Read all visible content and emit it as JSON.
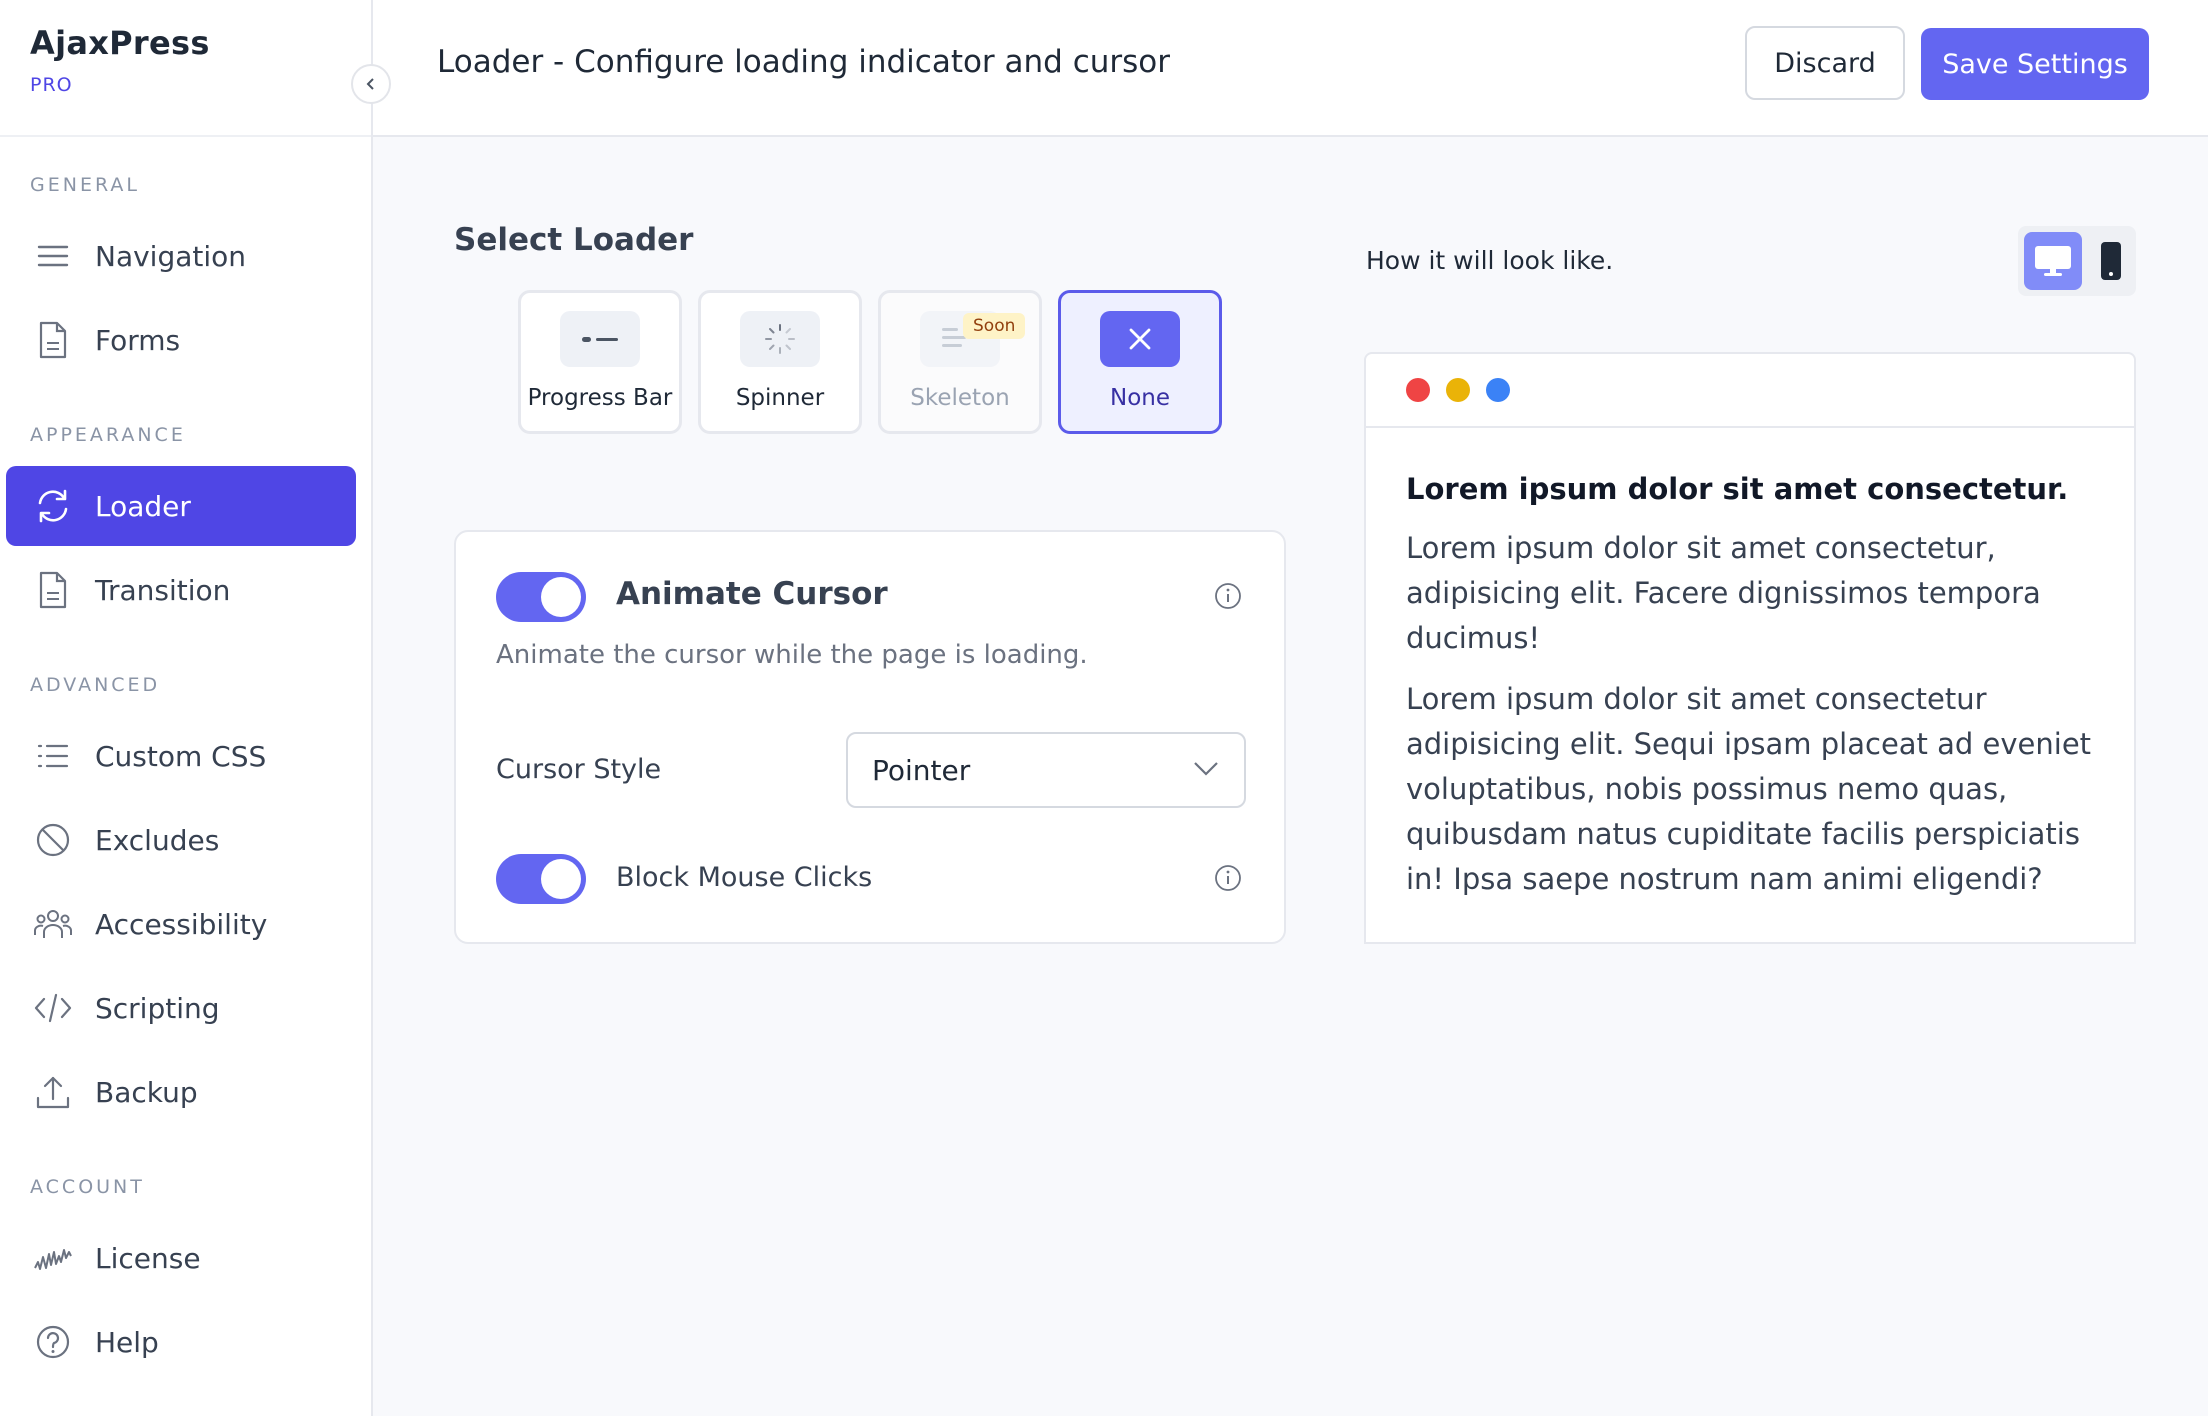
{
  "brand": {
    "name": "AjaxPress",
    "tier": "PRO"
  },
  "sidebar": {
    "sections": [
      {
        "title": "GENERAL"
      },
      {
        "title": "APPEARANCE"
      },
      {
        "title": "ADVANCED"
      },
      {
        "title": "ACCOUNT"
      }
    ],
    "items": [
      {
        "label": "Navigation",
        "icon": "menu-icon"
      },
      {
        "label": "Forms",
        "icon": "document-icon"
      },
      {
        "label": "Loader",
        "icon": "refresh-icon",
        "active": true
      },
      {
        "label": "Transition",
        "icon": "document-icon"
      },
      {
        "label": "Custom CSS",
        "icon": "list-icon"
      },
      {
        "label": "Excludes",
        "icon": "ban-icon"
      },
      {
        "label": "Accessibility",
        "icon": "users-icon"
      },
      {
        "label": "Scripting",
        "icon": "code-icon"
      },
      {
        "label": "Backup",
        "icon": "upload-icon"
      },
      {
        "label": "License",
        "icon": "signature-icon"
      },
      {
        "label": "Help",
        "icon": "help-icon"
      }
    ]
  },
  "header": {
    "title": "Loader - Configure loading indicator and cursor",
    "discard_label": "Discard",
    "save_label": "Save Settings"
  },
  "loader": {
    "title": "Select Loader",
    "options": [
      {
        "label": "Progress Bar",
        "icon": "progress-bar-icon"
      },
      {
        "label": "Spinner",
        "icon": "spinner-icon"
      },
      {
        "label": "Skeleton",
        "icon": "skeleton-icon",
        "badge": "Soon",
        "disabled": true
      },
      {
        "label": "None",
        "icon": "close-icon",
        "selected": true
      }
    ]
  },
  "settings": {
    "animate_cursor": {
      "title": "Animate Cursor",
      "description": "Animate the cursor while the page is loading.",
      "enabled": true
    },
    "cursor_style": {
      "label": "Cursor Style",
      "value": "Pointer"
    },
    "block_clicks": {
      "label": "Block Mouse Clicks",
      "enabled": true
    }
  },
  "preview": {
    "label": "How it will look like.",
    "heading": "Lorem ipsum dolor sit amet consectetur.",
    "paragraphs": [
      "Lorem ipsum dolor sit amet consectetur, adipisicing elit. Facere dignissimos tempora ducimus!",
      "Lorem ipsum dolor sit amet consectetur adipisicing elit. Sequi ipsam placeat ad eveniet voluptatibus, nobis possimus nemo quas, quibusdam natus cupiditate facilis perspiciatis in! Ipsa saepe nostrum nam animi eligendi?"
    ],
    "dot_colors": [
      "#ef4444",
      "#eab308",
      "#3b82f6"
    ]
  },
  "colors": {
    "accent": "#4f46e5",
    "toggle_on": "#6366f1",
    "badge_bg": "#fef3c7"
  }
}
